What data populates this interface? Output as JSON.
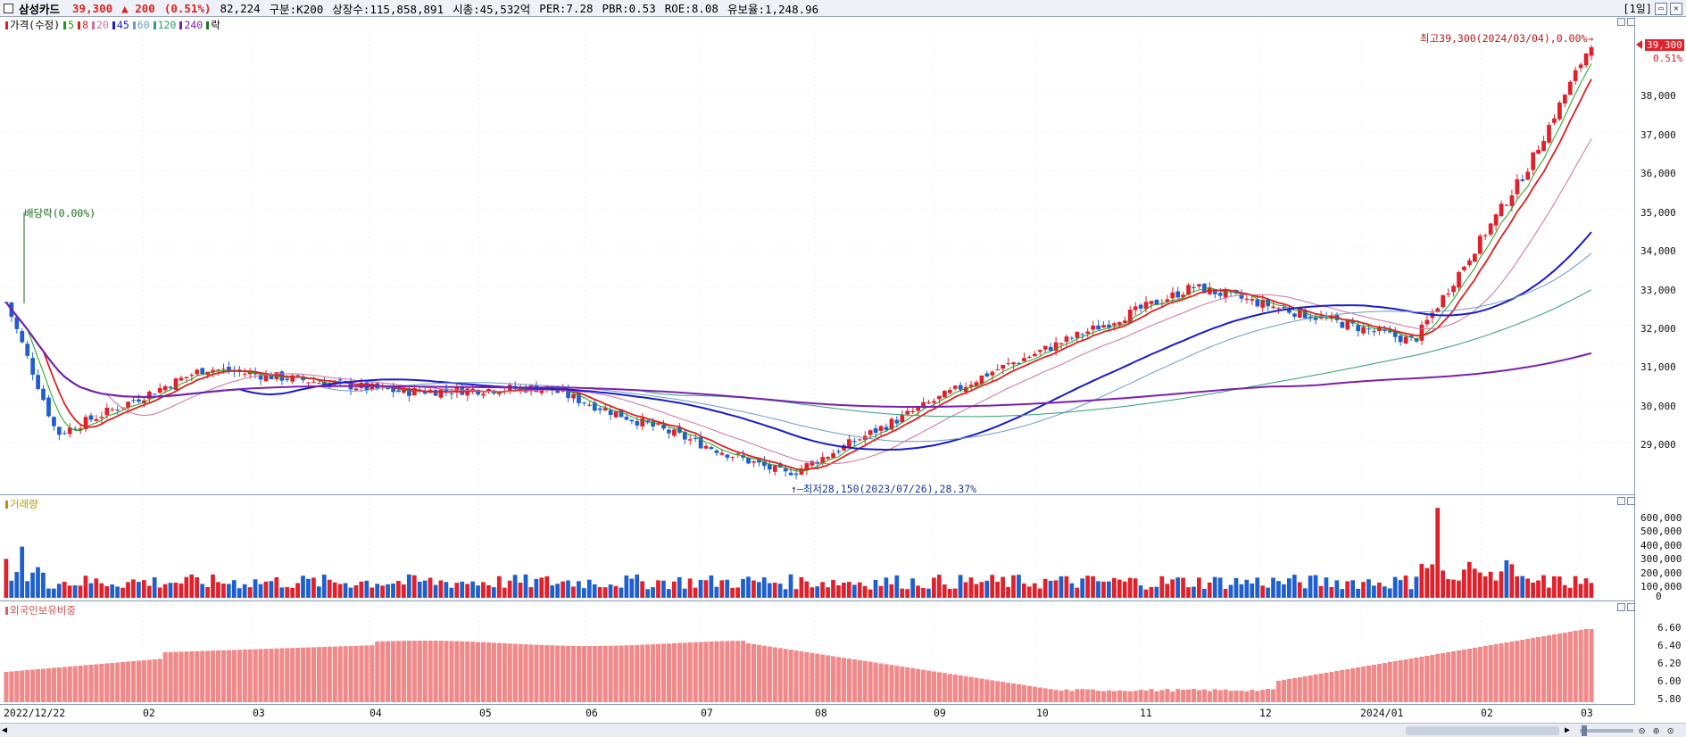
{
  "header": {
    "stock_name": "삼성카드",
    "price": "39,300",
    "change": "▲ 200",
    "change_pct": "(0.51%)",
    "volume": "82,224",
    "category": "구분:K200",
    "shares": "상장수:115,858,891",
    "market_cap": "시총:45,532억",
    "per": "PER:7.28",
    "pbr": "PBR:0.53",
    "roe": "ROE:8.08",
    "float_ratio": "유보율:1,248.96",
    "period": "[1일]"
  },
  "legend": {
    "price_label": "가격(수정)",
    "ma": [
      {
        "label": "5",
        "color": "#1aa31a"
      },
      {
        "label": "8",
        "color": "#e02020"
      },
      {
        "label": "20",
        "color": "#d070a0"
      },
      {
        "label": "45",
        "color": "#1a1ad0"
      },
      {
        "label": "60",
        "color": "#6a9cc8"
      },
      {
        "label": "120",
        "color": "#30a070"
      },
      {
        "label": "240",
        "color": "#7a20b0"
      }
    ],
    "ex_label": "락"
  },
  "price_axis": {
    "ticks": [
      "38,000",
      "37,000",
      "36,000",
      "35,000",
      "34,000",
      "33,000",
      "32,000",
      "31,000",
      "30,000",
      "29,000"
    ],
    "current_tag": "39,300",
    "current_pct": "0.51%"
  },
  "annotations": {
    "high": "최고39,300(2024/03/04),0.00%→",
    "low": "↑—최저28,150(2023/07/26),28.37%",
    "dividend": "배당락(0.00%)"
  },
  "volume_panel": {
    "title": "거래량",
    "ticks": [
      "600,000",
      "500,000",
      "400,000",
      "300,000",
      "200,000",
      "100,000",
      "0"
    ]
  },
  "foreign_panel": {
    "title": "외국인보유비중",
    "ticks": [
      "6.60",
      "6.40",
      "6.20",
      "6.00",
      "5.80"
    ]
  },
  "x_axis": {
    "labels": [
      "2022/12/22",
      "02",
      "03",
      "04",
      "05",
      "06",
      "07",
      "08",
      "09",
      "10",
      "11",
      "12",
      "2024/01",
      "02",
      "03"
    ]
  },
  "colors": {
    "up": "#e0202a",
    "down": "#1e5fd0",
    "foreign_bar": "#f08a8a",
    "ma45": "#1a1ad0",
    "ma240": "#7a20b0"
  },
  "chart_data": [
    {
      "type": "candlestick",
      "title": "삼성카드",
      "ylim": [
        28150,
        39300
      ],
      "x_range": [
        "2022/12/22",
        "2024/03/04"
      ],
      "anchor_prices": [
        {
          "date": "2022/12/22",
          "close": 32600
        },
        {
          "date": "2023/01/05",
          "close": 29200
        },
        {
          "date": "2023/02/15",
          "close": 30900
        },
        {
          "date": "2023/04/10",
          "close": 30300
        },
        {
          "date": "2023/05/20",
          "close": 30400
        },
        {
          "date": "2023/07/26",
          "close": 28150
        },
        {
          "date": "2023/09/20",
          "close": 30800
        },
        {
          "date": "2023/11/15",
          "close": 33000
        },
        {
          "date": "2024/01/15",
          "close": 31600
        },
        {
          "date": "2024/02/15",
          "close": 36000
        },
        {
          "date": "2024/03/04",
          "close": 39300
        }
      ],
      "high_point": {
        "date": "2024/03/04",
        "value": 39300
      },
      "low_point": {
        "date": "2023/07/26",
        "value": 28150
      },
      "moving_averages": [
        "5",
        "8",
        "20",
        "45",
        "60",
        "120",
        "240"
      ]
    },
    {
      "type": "bar",
      "title": "거래량",
      "ylim": [
        0,
        600000
      ],
      "peak": 650000
    },
    {
      "type": "bar",
      "title": "외국인보유비중",
      "ylim": [
        5.8,
        6.6
      ]
    }
  ]
}
